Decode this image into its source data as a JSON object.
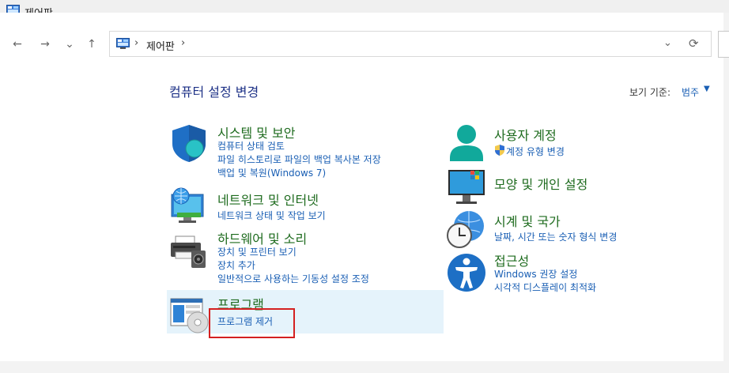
{
  "window": {
    "title": "제어판"
  },
  "nav": {
    "back": "←",
    "forward": "→",
    "recent": "⌄",
    "up": "↑"
  },
  "address": {
    "sep": "›",
    "location": "제어판",
    "dropdown": "⌄",
    "refresh": "⟳"
  },
  "page": {
    "title": "컴퓨터 설정 변경",
    "view_by_label": "보기 기준:",
    "view_by_value": "범주",
    "view_by_arrow": "▼"
  },
  "categories": [
    {
      "title": "시스템 및 보안",
      "icon": "shield-icon",
      "links": [
        "컴퓨터 상태 검토",
        "파일 히스토리로 파일의 백업 복사본 저장",
        "백업 및 복원(Windows 7)"
      ]
    },
    {
      "title": "네트워크 및 인터넷",
      "icon": "network-icon",
      "links": [
        "네트워크 상태 및 작업 보기"
      ]
    },
    {
      "title": "하드웨어 및 소리",
      "icon": "printer-icon",
      "links": [
        "장치 및 프린터 보기",
        "장치 추가",
        "일반적으로 사용하는 기동성 설정 조정"
      ]
    },
    {
      "title": "프로그램",
      "icon": "programs-icon",
      "links": [
        "프로그램 제거"
      ]
    },
    {
      "title": "사용자 계정",
      "icon": "user-icon",
      "links": [
        "계정 유형 변경"
      ]
    },
    {
      "title": "모양 및 개인 설정",
      "icon": "monitor-icon",
      "links": []
    },
    {
      "title": "시계 및 국가",
      "icon": "clock-icon",
      "links": [
        "날짜, 시간 또는 숫자 형식 변경"
      ]
    },
    {
      "title": "접근성",
      "icon": "accessibility-icon",
      "links": [
        "Windows 권장 설정",
        "시각적 디스플레이 최적화"
      ]
    }
  ],
  "colors": {
    "category_title": "#1e6b1e",
    "link": "#1a5fb4",
    "page_title": "#1e3287",
    "highlight": "#e5f3fb",
    "annotation": "#d42020"
  }
}
